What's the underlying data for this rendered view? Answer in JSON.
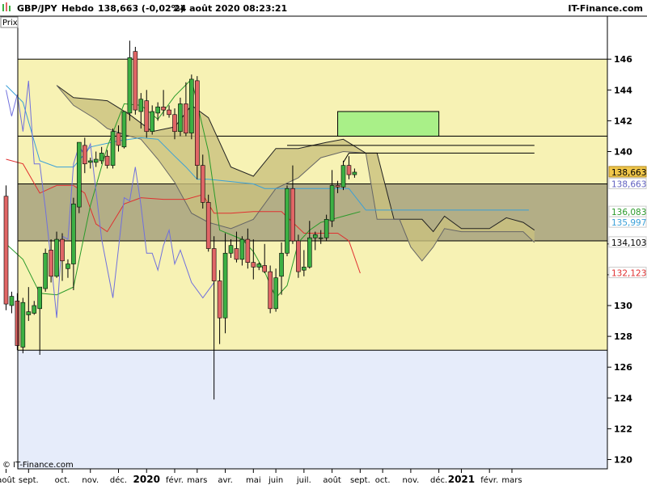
{
  "header": {
    "symbol": "GBP/JPY",
    "timeframe": "Hebdo",
    "quote": "138,663 (-0,02%)",
    "datetime": "24 août 2020 08:23:21",
    "brand": "IT-Finance.com",
    "axis_button": "Prix"
  },
  "copyright": "© IT-Finance.com",
  "colors": {
    "up": "#3cb043",
    "down": "#e06666",
    "zone_yellow": "#f7f2b4",
    "zone_blue": "#e6ecfa",
    "band": "#b3ae86",
    "target_box": "#a9f088",
    "kumo": "#c9c07e",
    "tenkan": "#e03030",
    "kijun": "#3aa0d8",
    "chikou": "#7070dd",
    "lagging_green": "#2a9a2a"
  },
  "chart_data": {
    "type": "candlestick",
    "ylim": [
      118,
      148
    ],
    "y_ticks": [
      {
        "value": 146,
        "label": "146"
      },
      {
        "value": 144,
        "label": "144"
      },
      {
        "value": 142,
        "label": "142"
      },
      {
        "value": 140,
        "label": "140"
      },
      {
        "value": 134,
        "label": "134"
      },
      {
        "value": 132,
        "label": "132"
      },
      {
        "value": 130,
        "label": "130"
      },
      {
        "value": 128,
        "label": "128"
      },
      {
        "value": 126,
        "label": "126"
      },
      {
        "value": 124,
        "label": "124"
      },
      {
        "value": 122,
        "label": "122"
      },
      {
        "value": 120,
        "label": "120"
      }
    ],
    "x_ticks": [
      {
        "i": 0,
        "label": "août"
      },
      {
        "i": 4,
        "label": "sept."
      },
      {
        "i": 10,
        "label": "oct."
      },
      {
        "i": 15,
        "label": "nov."
      },
      {
        "i": 20,
        "label": "déc."
      },
      {
        "i": 25,
        "label": "2020",
        "year": true
      },
      {
        "i": 30,
        "label": "févr."
      },
      {
        "i": 34,
        "label": "mars"
      },
      {
        "i": 39,
        "label": "avr."
      },
      {
        "i": 44,
        "label": "mai"
      },
      {
        "i": 48,
        "label": "juin"
      },
      {
        "i": 53,
        "label": "juil."
      },
      {
        "i": 58,
        "label": "août"
      },
      {
        "i": 63,
        "label": "sept."
      },
      {
        "i": 67,
        "label": "oct."
      },
      {
        "i": 72,
        "label": "nov."
      },
      {
        "i": 77,
        "label": "déc."
      },
      {
        "i": 81,
        "label": "2021",
        "year": true
      },
      {
        "i": 86,
        "label": "févr."
      },
      {
        "i": 90,
        "label": "mars"
      }
    ],
    "price_labels": [
      {
        "value": 138.663,
        "label": "138,663",
        "bg": "#f0c64a",
        "fg": "#000000"
      },
      {
        "value": 137.9,
        "label": "138,663",
        "bg": "#ffffff",
        "fg": "#6060c0"
      },
      {
        "value": 136.083,
        "label": "136,083",
        "bg": "#ffffff",
        "fg": "#2a9a2a"
      },
      {
        "value": 135.4,
        "label": "135,997",
        "bg": "#ffffff",
        "fg": "#3aa0d8"
      },
      {
        "value": 134.103,
        "label": "134,103",
        "bg": "#ffffff",
        "fg": "#000000"
      },
      {
        "value": 132.123,
        "label": "132,123",
        "bg": "#ffffff",
        "fg": "#e03030"
      }
    ],
    "zones": {
      "yellow_upper": [
        141.0,
        146.0
      ],
      "yellow_lower": [
        127.1,
        141.0
      ],
      "band": [
        134.2,
        137.9
      ],
      "target_box": {
        "i0": 59,
        "i1": 77,
        "y0": 141.0,
        "y1": 142.6
      },
      "resistance_lines": [
        {
          "i0": 50,
          "i1": 94,
          "y": 140.4
        },
        {
          "i0": 61,
          "i1": 94,
          "y": 139.9
        }
      ]
    },
    "candles": [
      [
        137.1,
        137.8,
        129.7,
        130.1
      ],
      [
        130.0,
        130.9,
        129.5,
        130.6
      ],
      [
        130.3,
        130.8,
        127.1,
        127.4
      ],
      [
        127.3,
        130.5,
        126.9,
        130.2
      ],
      [
        129.4,
        131.2,
        129.0,
        129.6
      ],
      [
        129.5,
        130.3,
        129.4,
        130.0
      ],
      [
        129.8,
        131.2,
        126.8,
        131.2
      ],
      [
        131.1,
        133.7,
        130.9,
        133.4
      ],
      [
        133.6,
        134.3,
        131.5,
        131.9
      ],
      [
        131.9,
        134.8,
        131.8,
        134.3
      ],
      [
        134.3,
        134.7,
        131.6,
        132.9
      ],
      [
        132.4,
        133.0,
        131.8,
        132.7
      ],
      [
        132.7,
        137.0,
        131.0,
        136.6
      ],
      [
        136.4,
        140.6,
        136.0,
        140.6
      ],
      [
        140.4,
        140.9,
        138.6,
        139.2
      ],
      [
        139.3,
        139.6,
        138.9,
        139.4
      ],
      [
        139.3,
        140.0,
        139.0,
        139.5
      ],
      [
        139.4,
        140.3,
        139.2,
        139.9
      ],
      [
        139.7,
        140.1,
        138.9,
        139.1
      ],
      [
        139.1,
        141.5,
        138.9,
        141.3
      ],
      [
        141.2,
        141.7,
        140.0,
        140.4
      ],
      [
        140.3,
        142.6,
        140.2,
        142.6
      ],
      [
        142.5,
        147.2,
        142.0,
        146.1
      ],
      [
        146.5,
        146.8,
        142.4,
        142.7
      ],
      [
        142.6,
        143.8,
        141.5,
        143.4
      ],
      [
        143.3,
        144.0,
        140.9,
        141.3
      ],
      [
        141.3,
        143.0,
        141.1,
        142.6
      ],
      [
        142.5,
        143.2,
        142.0,
        142.9
      ],
      [
        142.9,
        144.0,
        142.3,
        142.7
      ],
      [
        142.7,
        143.0,
        142.2,
        142.4
      ],
      [
        142.4,
        142.8,
        140.8,
        141.3
      ],
      [
        141.3,
        143.5,
        141.0,
        143.1
      ],
      [
        143.1,
        144.5,
        141.0,
        141.2
      ],
      [
        141.2,
        145.0,
        140.8,
        144.7
      ],
      [
        144.6,
        144.9,
        138.2,
        139.1
      ],
      [
        139.1,
        139.8,
        136.3,
        136.7
      ],
      [
        136.7,
        137.2,
        133.5,
        133.7
      ],
      [
        133.7,
        134.5,
        123.9,
        131.6
      ],
      [
        131.6,
        132.3,
        127.5,
        129.2
      ],
      [
        129.2,
        134.7,
        128.2,
        133.4
      ],
      [
        133.4,
        134.3,
        133.1,
        133.9
      ],
      [
        133.7,
        134.8,
        132.8,
        133.0
      ],
      [
        133.0,
        134.5,
        132.6,
        134.3
      ],
      [
        134.3,
        135.0,
        132.4,
        132.8
      ],
      [
        132.8,
        134.3,
        131.7,
        132.5
      ],
      [
        132.5,
        132.8,
        132.3,
        132.7
      ],
      [
        132.6,
        134.0,
        132.1,
        132.2
      ],
      [
        132.2,
        132.6,
        129.5,
        129.8
      ],
      [
        129.8,
        132.4,
        129.6,
        131.8
      ],
      [
        131.9,
        134.1,
        130.7,
        133.4
      ],
      [
        133.4,
        137.8,
        133.2,
        137.6
      ],
      [
        137.6,
        139.1,
        134.0,
        134.2
      ],
      [
        134.2,
        134.6,
        131.8,
        132.2
      ],
      [
        132.3,
        133.6,
        131.9,
        132.5
      ],
      [
        132.5,
        135.5,
        132.4,
        134.4
      ],
      [
        134.4,
        134.8,
        133.6,
        134.6
      ],
      [
        134.4,
        134.9,
        134.0,
        134.4
      ],
      [
        134.4,
        135.9,
        134.2,
        135.6
      ],
      [
        135.5,
        138.8,
        135.1,
        137.8
      ],
      [
        137.8,
        138.1,
        137.3,
        137.7
      ],
      [
        137.7,
        139.4,
        137.5,
        139.1
      ],
      [
        139.1,
        139.7,
        138.2,
        138.5
      ],
      [
        138.5,
        138.9,
        138.3,
        138.663
      ]
    ],
    "kumo_top": [
      [
        9,
        144.3
      ],
      [
        12,
        143.5
      ],
      [
        18,
        143.3
      ],
      [
        22,
        142.4
      ],
      [
        26,
        141.3
      ],
      [
        30,
        141.6
      ],
      [
        33,
        143.0
      ],
      [
        36,
        142.2
      ],
      [
        40,
        139.0
      ],
      [
        44,
        138.4
      ],
      [
        48,
        140.2
      ],
      [
        52,
        140.2
      ],
      [
        57,
        140.6
      ],
      [
        60,
        140.8
      ],
      [
        64,
        139.9
      ],
      [
        66,
        139.9
      ],
      [
        69,
        135.6
      ],
      [
        74,
        135.6
      ],
      [
        76,
        134.8
      ],
      [
        78,
        135.8
      ],
      [
        81,
        135.0
      ],
      [
        86,
        135.0
      ],
      [
        89,
        135.7
      ],
      [
        92,
        135.4
      ],
      [
        94,
        134.9
      ]
    ],
    "kumo_bottom": [
      [
        9,
        144.3
      ],
      [
        12,
        143.0
      ],
      [
        16,
        142.1
      ],
      [
        18,
        141.5
      ],
      [
        21,
        141.1
      ],
      [
        24,
        140.8
      ],
      [
        27,
        139.5
      ],
      [
        30,
        138.0
      ],
      [
        33,
        136.0
      ],
      [
        36,
        135.4
      ],
      [
        40,
        135.0
      ],
      [
        44,
        135.6
      ],
      [
        48,
        137.6
      ],
      [
        52,
        138.3
      ],
      [
        56,
        139.6
      ],
      [
        60,
        140.0
      ],
      [
        64,
        139.9
      ],
      [
        66,
        135.6
      ],
      [
        70,
        135.6
      ],
      [
        72,
        133.8
      ],
      [
        74,
        132.9
      ],
      [
        76,
        133.8
      ],
      [
        78,
        135.0
      ],
      [
        81,
        134.8
      ],
      [
        86,
        134.8
      ],
      [
        89,
        134.8
      ],
      [
        92,
        134.8
      ],
      [
        94,
        134.1
      ]
    ],
    "series": [
      {
        "key": "tenkan",
        "points": [
          [
            0,
            139.5
          ],
          [
            3,
            139.2
          ],
          [
            6,
            137.3
          ],
          [
            9,
            137.8
          ],
          [
            12,
            137.8
          ],
          [
            14,
            137.3
          ],
          [
            16,
            135.3
          ],
          [
            18,
            134.8
          ],
          [
            21,
            136.6
          ],
          [
            24,
            137.0
          ],
          [
            28,
            136.9
          ],
          [
            32,
            136.9
          ],
          [
            35,
            137.2
          ],
          [
            37,
            136.0
          ],
          [
            40,
            136.0
          ],
          [
            44,
            136.1
          ],
          [
            49,
            136.1
          ],
          [
            53,
            134.7
          ],
          [
            56,
            134.7
          ],
          [
            59,
            134.7
          ],
          [
            61,
            134.2
          ],
          [
            63,
            132.1
          ]
        ]
      },
      {
        "key": "kijun",
        "points": [
          [
            0,
            144.3
          ],
          [
            3,
            143.2
          ],
          [
            6,
            139.4
          ],
          [
            9,
            139.0
          ],
          [
            12,
            139.0
          ],
          [
            15,
            140.3
          ],
          [
            20,
            140.7
          ],
          [
            24,
            140.9
          ],
          [
            27,
            140.8
          ],
          [
            30,
            139.7
          ],
          [
            32,
            139.0
          ],
          [
            34,
            138.2
          ],
          [
            36,
            138.2
          ],
          [
            44,
            137.9
          ],
          [
            46,
            137.6
          ],
          [
            55,
            137.6
          ],
          [
            61,
            137.6
          ],
          [
            64,
            136.2
          ],
          [
            76,
            136.2
          ],
          [
            86,
            136.2
          ],
          [
            93,
            136.2
          ]
        ]
      },
      {
        "key": "lagging_green",
        "points": [
          [
            0,
            134.0
          ],
          [
            3,
            133.0
          ],
          [
            6,
            130.8
          ],
          [
            9,
            130.7
          ],
          [
            12,
            131.2
          ],
          [
            15,
            136.5
          ],
          [
            18,
            140.3
          ],
          [
            21,
            143.1
          ],
          [
            24,
            143.0
          ],
          [
            27,
            142.1
          ],
          [
            30,
            143.6
          ],
          [
            33,
            144.7
          ],
          [
            36,
            140.0
          ],
          [
            38,
            134.9
          ],
          [
            40,
            134.6
          ],
          [
            42,
            134.3
          ],
          [
            44,
            133.5
          ],
          [
            46,
            132.2
          ],
          [
            48,
            130.5
          ],
          [
            50,
            131.3
          ],
          [
            52,
            134.1
          ],
          [
            54,
            134.9
          ],
          [
            56,
            135.4
          ],
          [
            58,
            135.6
          ],
          [
            59,
            135.7
          ],
          [
            61,
            135.9
          ],
          [
            63,
            136.1
          ]
        ]
      },
      {
        "key": "chikou",
        "points": [
          [
            0,
            144.0
          ],
          [
            1,
            142.3
          ],
          [
            2,
            143.7
          ],
          [
            3,
            141.3
          ],
          [
            4,
            144.6
          ],
          [
            5,
            139.2
          ],
          [
            6,
            139.2
          ],
          [
            7,
            136.3
          ],
          [
            8,
            132.9
          ],
          [
            9,
            129.2
          ],
          [
            10,
            134.5
          ],
          [
            11,
            134.3
          ],
          [
            12,
            139.2
          ],
          [
            13,
            140.4
          ],
          [
            14,
            139.7
          ],
          [
            15,
            140.5
          ],
          [
            17,
            134.3
          ],
          [
            19,
            130.5
          ],
          [
            20,
            133.7
          ],
          [
            21,
            137.0
          ],
          [
            22,
            136.8
          ],
          [
            23,
            139.0
          ],
          [
            24,
            136.5
          ],
          [
            25,
            133.4
          ],
          [
            26,
            133.4
          ],
          [
            27,
            132.3
          ],
          [
            28,
            133.9
          ],
          [
            29,
            134.9
          ],
          [
            30,
            132.7
          ],
          [
            31,
            133.6
          ],
          [
            33,
            131.5
          ],
          [
            35,
            130.5
          ],
          [
            37,
            131.5
          ]
        ]
      }
    ]
  }
}
